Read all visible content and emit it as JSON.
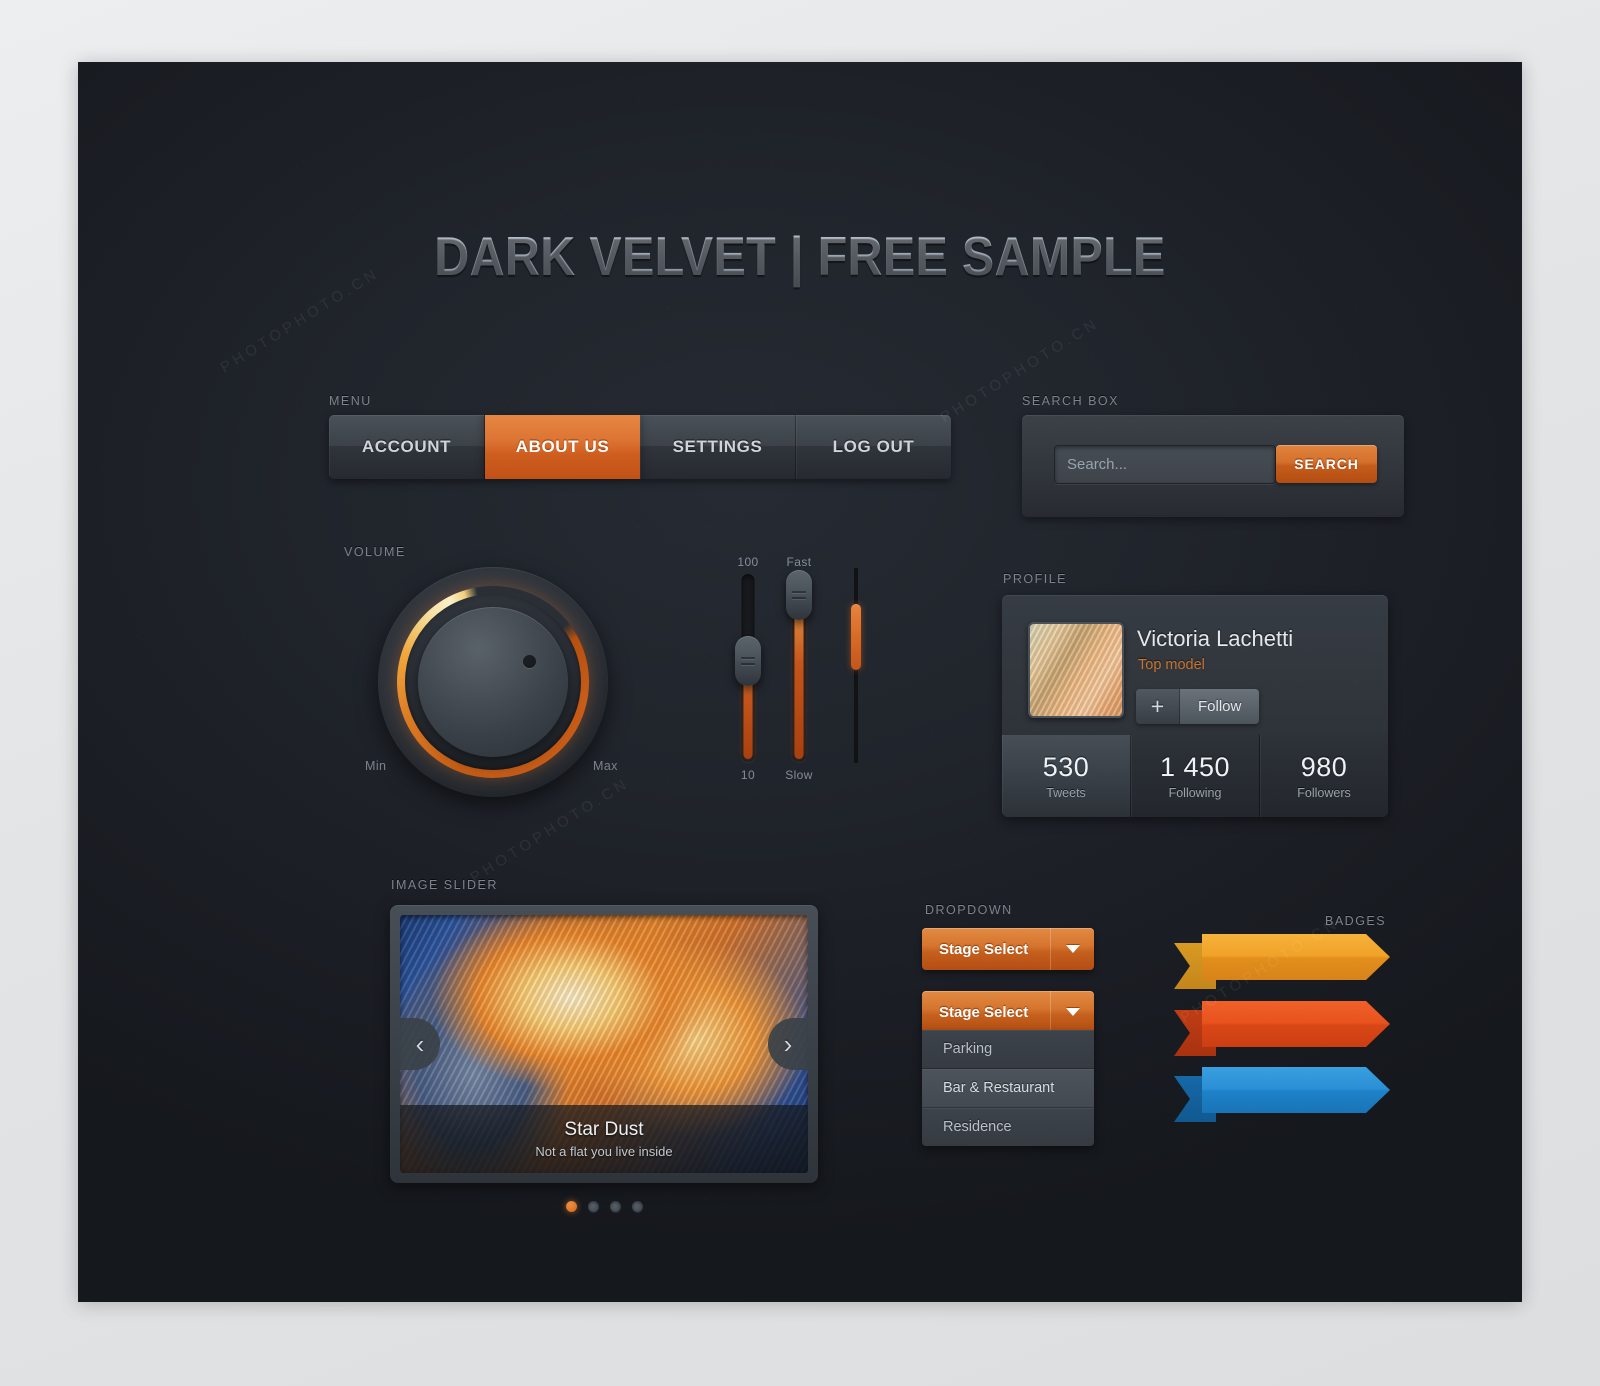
{
  "page": {
    "title": "DARK VELVET | FREE SAMPLE",
    "accent_orange": "#d5752e",
    "panel_bg": "#20242b",
    "page_bg": "#e8eaec"
  },
  "menu": {
    "caption": "MENU",
    "items": [
      {
        "label": "ACCOUNT",
        "active": false
      },
      {
        "label": "ABOUT US",
        "active": true
      },
      {
        "label": "SETTINGS",
        "active": false
      },
      {
        "label": "LOG OUT",
        "active": false
      }
    ]
  },
  "search": {
    "caption": "SEARCH BOX",
    "placeholder": "Search...",
    "value": "",
    "button_label": "SEARCH"
  },
  "volume": {
    "caption": "VOLUME",
    "min_label": "Min",
    "max_label": "Max"
  },
  "sliders": [
    {
      "top_label": "100",
      "bottom_label": "10"
    },
    {
      "top_label": "Fast",
      "bottom_label": "Slow"
    }
  ],
  "profile": {
    "caption": "PROFILE",
    "name": "Victoria Lachetti",
    "role": "Top model",
    "follow_plus": "+",
    "follow_label": "Follow",
    "stats": [
      {
        "value": "530",
        "label": "Tweets",
        "active": true
      },
      {
        "value": "1 450",
        "label": "Following",
        "active": false
      },
      {
        "value": "980",
        "label": "Followers",
        "active": false
      }
    ]
  },
  "image_slider": {
    "caption": "IMAGE SLIDER",
    "slide_title": "Star Dust",
    "slide_subtitle": "Not a flat you live inside",
    "prev_icon": "‹",
    "next_icon": "›",
    "dots": [
      {
        "active": true
      },
      {
        "active": false
      },
      {
        "active": false
      },
      {
        "active": false
      }
    ]
  },
  "dropdown": {
    "caption": "DROPDOWN",
    "closed_label": "Stage Select",
    "open_label": "Stage Select",
    "options": [
      {
        "label": "Parking",
        "hover": false
      },
      {
        "label": "Bar & Restaurant",
        "hover": true
      },
      {
        "label": "Residence",
        "hover": false
      }
    ]
  },
  "badges": {
    "caption": "BADGES",
    "items": [
      {
        "color": "#f0a128"
      },
      {
        "color": "#e8521d"
      },
      {
        "color": "#2a8fd4"
      }
    ]
  },
  "watermarks": {
    "text": "PHOTOPHOTO.CN"
  }
}
